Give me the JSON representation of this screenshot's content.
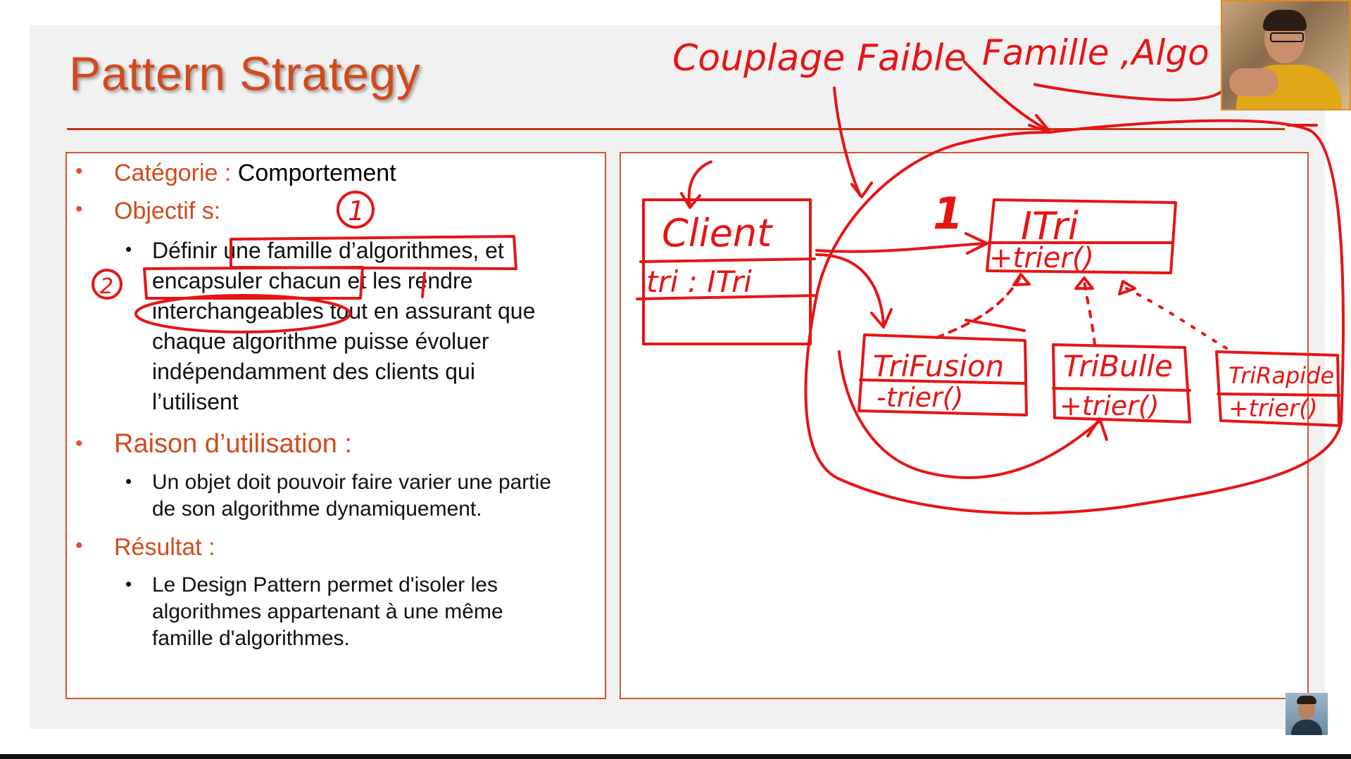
{
  "slide": {
    "title": "Pattern Strategy",
    "left_panel": {
      "categorie_label": "Catégorie :",
      "categorie_value": "Comportement",
      "objectif_label": "Objectif s:",
      "objectif_lines": [
        "Définir une famille d’algorithmes, et",
        "encapsuler chacun et les rendre",
        "interchangeables tout en assurant que",
        "chaque algorithme puisse évoluer",
        "indépendamment des clients qui",
        "l’utilisent"
      ],
      "raison_label": "Raison d’utilisation :",
      "raison_lines": [
        "Un objet doit pouvoir faire varier une partie",
        "de son algorithme dynamiquement."
      ],
      "resultat_label": "Résultat :",
      "resultat_lines": [
        "Le Design Pattern permet d'isoler les",
        "algorithmes appartenant à une même",
        "famille d'algorithmes."
      ]
    },
    "annotations": {
      "couplage": "Couplage Faible",
      "famille": "Famille ,Algo",
      "num_one": "1",
      "num_two": "2",
      "big_one": "1",
      "client_name": "Client",
      "client_attr": "tri : ITri",
      "itri_name": "ITri",
      "itri_method": "+trier()",
      "trifusion_name": "TriFusion",
      "trifusion_method": "-trier()",
      "tribulle_name": "TriBulle",
      "tribulle_method": "+trier()",
      "trirapide_name": "TriRapide",
      "trirapide_method": "+trier()"
    }
  },
  "colors": {
    "accent": "#d24a1c",
    "ink": "#e81414",
    "border": "#d9542b"
  },
  "icons": {
    "webcam": "presenter-webcam",
    "thumbnail": "participant-thumbnail"
  }
}
